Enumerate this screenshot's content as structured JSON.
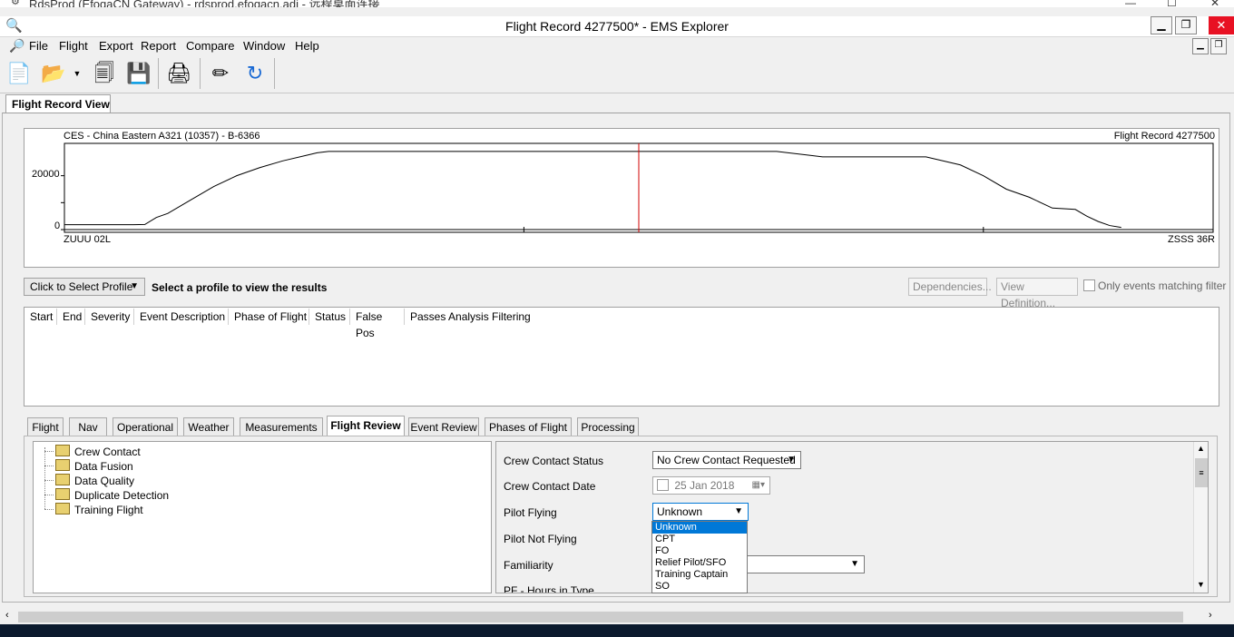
{
  "rdp": {
    "title": "RdsProd (EfoqaCN Gateway) - rdsprod.efoqacn.adi - 远程桌面连接",
    "minimize": "—",
    "maximize": "☐",
    "close": "✕"
  },
  "app": {
    "title": "Flight Record 4277500* - EMS Explorer",
    "minimize": "▁",
    "restore": "❐",
    "close": "✕"
  },
  "menu": [
    "File",
    "Flight",
    "Export",
    "Report",
    "Compare",
    "Window",
    "Help"
  ],
  "view_tab": "Flight Record View",
  "chart_data": {
    "type": "line",
    "title_left": "CES - China Eastern A321 (10357) - B-6366",
    "title_right": "Flight Record 4277500",
    "origin": "ZUUU 02L",
    "destination": "ZSSS 36R",
    "y_ticks": [
      "20000",
      "0"
    ],
    "y_values_ticks": [
      20000,
      0
    ],
    "ylim": [
      -1000,
      32000
    ],
    "x": [
      0,
      0.06,
      0.07,
      0.08,
      0.09,
      0.11,
      0.13,
      0.15,
      0.17,
      0.19,
      0.21,
      0.22,
      0.23,
      0.3,
      0.55,
      0.62,
      0.66,
      0.71,
      0.75,
      0.78,
      0.8,
      0.82,
      0.84,
      0.86,
      0.88,
      0.89,
      0.9,
      0.91,
      0.92
    ],
    "values": [
      1800,
      1800,
      1900,
      4500,
      6000,
      11000,
      16000,
      20000,
      23000,
      25500,
      27500,
      28500,
      29000,
      29000,
      29000,
      29000,
      27000,
      27000,
      27000,
      24000,
      20000,
      15000,
      12000,
      8000,
      7500,
      5000,
      3000,
      1500,
      800
    ],
    "cursor_x": 0.5,
    "cursor_color": "#d00000"
  },
  "profile": {
    "select_label": "Click to Select Profile",
    "hint": "Select a profile to view the results",
    "dependencies": "Dependencies...",
    "view_definition": "View Definition...",
    "only_events": "Only events matching filter"
  },
  "event_columns": [
    "Start",
    "End",
    "Severity",
    "Event Description",
    "Phase of Flight",
    "Status",
    "False Pos",
    "Passes Analysis Filtering"
  ],
  "detail_tabs": [
    "Flight",
    "Nav",
    "Operational",
    "Weather",
    "Measurements",
    "Flight Review",
    "Event Review",
    "Phases of Flight",
    "Processing"
  ],
  "active_tab": "Flight Review",
  "tree_items": [
    "Crew Contact",
    "Data Fusion",
    "Data Quality",
    "Duplicate Detection",
    "Training Flight"
  ],
  "form": {
    "crew_contact_status_label": "Crew Contact Status",
    "crew_contact_status_value": "No Crew Contact Requested",
    "crew_contact_date_label": "Crew Contact Date",
    "crew_contact_date_value": "25 Jan  2018",
    "pilot_flying_label": "Pilot Flying",
    "pilot_flying_value": "Unknown",
    "pilot_not_flying_label": "Pilot Not Flying",
    "familiarity_label": "Familiarity",
    "pf_hours_label": "PF - Hours in Type"
  },
  "dropdown_options": [
    "Unknown",
    "CPT",
    "FO",
    "Relief Pilot/SFO",
    "Training Captain",
    "SO"
  ],
  "dropdown_selected": "Unknown"
}
